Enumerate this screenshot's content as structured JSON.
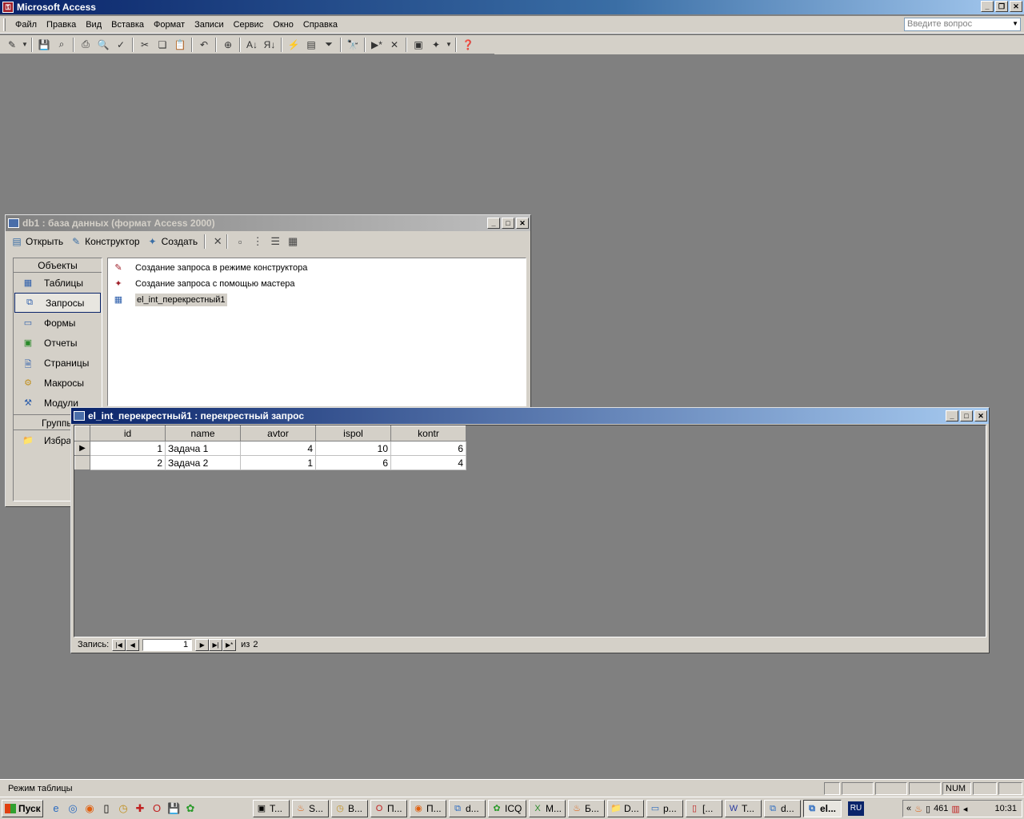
{
  "app": {
    "title": "Microsoft Access",
    "menu": [
      "Файл",
      "Правка",
      "Вид",
      "Вставка",
      "Формат",
      "Записи",
      "Сервис",
      "Окно",
      "Справка"
    ],
    "help_placeholder": "Введите вопрос"
  },
  "db_window": {
    "title": "db1 : база данных (формат Access 2000)",
    "toolbar": {
      "open": "Открыть",
      "design": "Конструктор",
      "create": "Создать"
    },
    "objects_header": "Объекты",
    "objects": [
      "Таблицы",
      "Запросы",
      "Формы",
      "Отчеты",
      "Страницы",
      "Макросы",
      "Модули"
    ],
    "groups_header": "Группы",
    "groups": [
      "Избранное"
    ],
    "list_items": [
      "Создание запроса в режиме конструктора",
      "Создание запроса с помощью мастера",
      "el_int_перекрестный1"
    ]
  },
  "query_window": {
    "title": "el_int_перекрестный1 : перекрестный запрос",
    "columns": [
      "id",
      "name",
      "avtor",
      "ispol",
      "kontr"
    ],
    "rows": [
      {
        "id": "1",
        "name": "Задача 1",
        "avtor": "4",
        "ispol": "10",
        "kontr": "6"
      },
      {
        "id": "2",
        "name": "Задача 2",
        "avtor": "1",
        "ispol": "6",
        "kontr": "4"
      }
    ],
    "nav": {
      "label": "Запись:",
      "current": "1",
      "of_label": "из",
      "total": "2"
    }
  },
  "statusbar": {
    "text": "Режим таблицы",
    "num": "NUM"
  },
  "taskbar": {
    "start": "Пуск",
    "tasks": [
      "T...",
      "S...",
      "B...",
      "П...",
      "П...",
      "d...",
      "ICQ",
      "M...",
      "Б...",
      "D...",
      "p...",
      "[...",
      "T...",
      "d...",
      "el..."
    ],
    "lang": "RU",
    "tray_num": "461",
    "clock": "10:31"
  }
}
